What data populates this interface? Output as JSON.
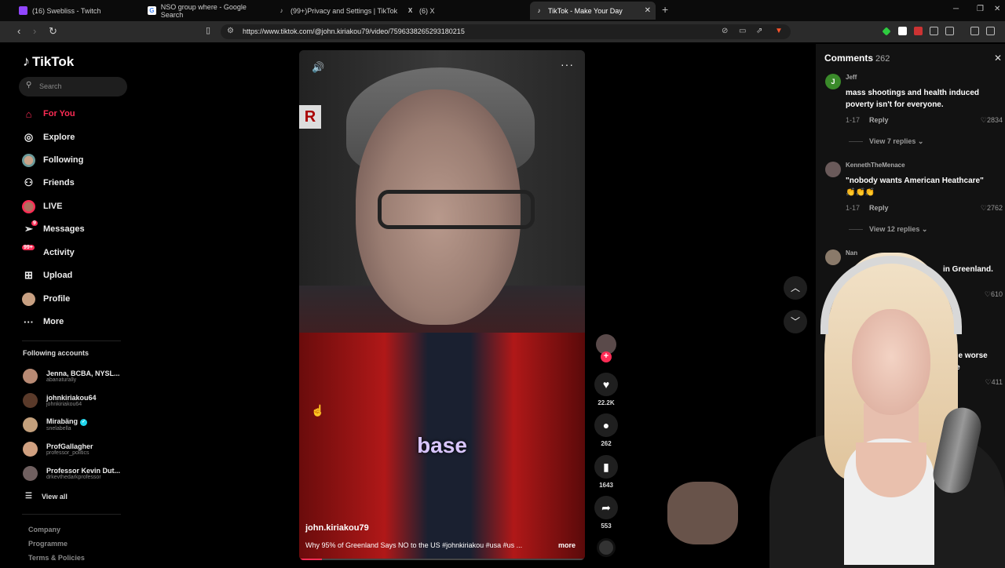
{
  "browser": {
    "tabs": [
      {
        "title": "(16) Swebliss - Twitch",
        "icon": "twitch-icon",
        "color": "#9146ff",
        "glyph": ""
      },
      {
        "title": "NSO group where - Google Search",
        "icon": "google-icon",
        "color": "#ffffff",
        "glyph": "G"
      },
      {
        "title": "(99+)Privacy and Settings | TikTok",
        "icon": "tiktok-icon",
        "color": "#000000",
        "glyph": "♪"
      },
      {
        "title": "(6) X",
        "icon": "x-icon",
        "color": "#000000",
        "glyph": "X"
      },
      {
        "title": "TikTok - Make Your Day",
        "icon": "tiktok-icon",
        "color": "#000000",
        "glyph": "♪"
      }
    ],
    "new_tab": "+",
    "url": "https://www.tiktok.com/@john.kiriakou79/video/7596338265293180215"
  },
  "sidebar": {
    "logo": "TikTok",
    "search_placeholder": "Search",
    "nav": [
      {
        "label": "For You",
        "icon": "home-icon",
        "glyph": "⌂",
        "active": true
      },
      {
        "label": "Explore",
        "icon": "compass-icon",
        "glyph": "◎"
      },
      {
        "label": "Following",
        "icon": "following-avatar-icon",
        "glyph": ""
      },
      {
        "label": "Friends",
        "icon": "friends-icon",
        "glyph": "⚇"
      },
      {
        "label": "LIVE",
        "icon": "live-avatar-icon",
        "glyph": ""
      },
      {
        "label": "Messages",
        "icon": "messages-icon",
        "glyph": "➢",
        "badge": "9"
      },
      {
        "label": "Activity",
        "icon": "activity-icon",
        "glyph": "",
        "badge": "99+"
      },
      {
        "label": "Upload",
        "icon": "upload-icon",
        "glyph": "⊞"
      },
      {
        "label": "Profile",
        "icon": "profile-avatar-icon",
        "glyph": ""
      },
      {
        "label": "More",
        "icon": "more-icon",
        "glyph": "···"
      }
    ],
    "following_title": "Following accounts",
    "accounts": [
      {
        "name": "Jenna, BCBA, NYSL...",
        "handle": "abanaturally",
        "color": "#b88a74"
      },
      {
        "name": "johnkiriakou64",
        "handle": "johnkiriakou64",
        "color": "#5a3a2a"
      },
      {
        "name": "Mirabäng",
        "handle": "snelabella",
        "color": "#c4a07c",
        "verified": true
      },
      {
        "name": "ProfGallagher",
        "handle": "professor_politics",
        "color": "#d0a080"
      },
      {
        "name": "Professor Kevin Dut...",
        "handle": "drkevthedarkprofessor",
        "color": "#706060"
      }
    ],
    "view_all": "View all",
    "footer": [
      "Company",
      "Programme",
      "Terms & Policies"
    ]
  },
  "video": {
    "author": "john.kiriakou79",
    "description": "Why 95% of Greenland Says NO to the US #johnkiriakou #usa #us ...",
    "more": "more",
    "caption_word": "base",
    "sign_letter": "R",
    "progress": 0.08
  },
  "actions": {
    "likes": "22.2K",
    "comments": "262",
    "saves": "1643",
    "shares": "553"
  },
  "comments": {
    "title": "Comments",
    "count": "262",
    "items": [
      {
        "user": "Jeff",
        "avatar_letter": "J",
        "avatar_color": "#3a8a2a",
        "text": "mass shootings and health induced poverty isn't for everyone.",
        "date": "1-17",
        "reply": "Reply",
        "likes": "2834",
        "view_replies": "View 7 replies"
      },
      {
        "user": "KennethTheMenace",
        "avatar_letter": "",
        "avatar_color": "#6a5a5a",
        "text": "\"nobody wants American Heathcare\" 👏👏👏",
        "date": "1-17",
        "reply": "Reply",
        "likes": "2762",
        "view_replies": "View 12 replies"
      },
      {
        "user": "Nan",
        "avatar_letter": "",
        "avatar_color": "#8a7a6a",
        "text": "in Greenland.",
        "likes": "610"
      },
      {
        "user": "",
        "avatar_letter": "",
        "avatar_color": "#555555",
        "text": "choose worse choice",
        "likes": "411"
      }
    ]
  }
}
